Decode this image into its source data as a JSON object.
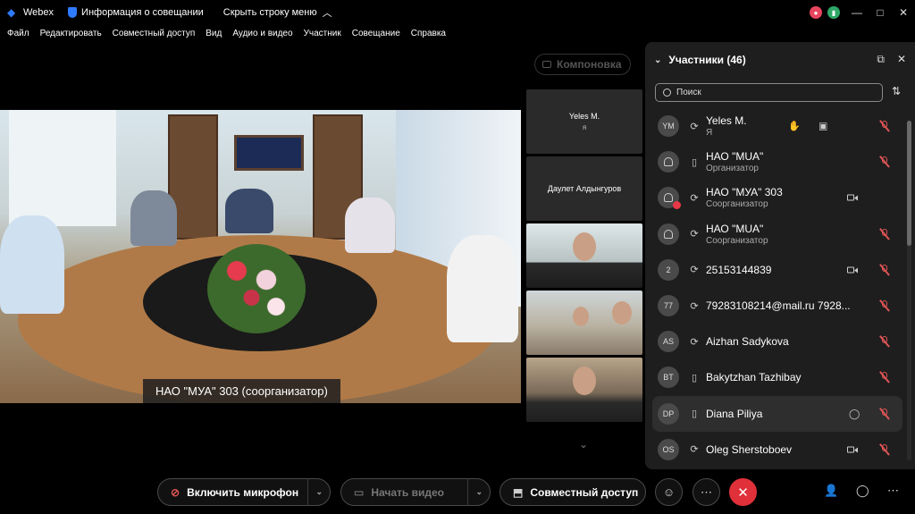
{
  "titlebar": {
    "app": "Webex",
    "meeting_info": "Информация о совещании",
    "hide_bar": "Скрыть строку меню",
    "minimize": "—",
    "maximize": "□",
    "close": "✕"
  },
  "menu": [
    "Файл",
    "Редактировать",
    "Совместный доступ",
    "Вид",
    "Аудио и видео",
    "Участник",
    "Совещание",
    "Справка"
  ],
  "layout_button": "Компоновка",
  "main_video": {
    "caption": "НАО \"МУА\" 303 (соорганизатор)"
  },
  "tiles": [
    {
      "name": "Yeles M.",
      "sub": "я"
    },
    {
      "name": "Даулет Алдынгуров",
      "sub": ""
    }
  ],
  "panel": {
    "title": "Участники (46)",
    "search_placeholder": "Поиск",
    "participants": [
      {
        "initials": "YM",
        "name": "Yeles M.",
        "role": "Я",
        "device": "sync",
        "hand": true,
        "cc": true,
        "video": false,
        "muted": true
      },
      {
        "initials": "",
        "name": "НАО \"МUA\"",
        "role": "Организатор",
        "device": "phone",
        "video": false,
        "muted": true
      },
      {
        "initials": "",
        "name": "НАО \"МУА\" 303",
        "role": "Соорганизатор",
        "device": "sync",
        "video": true,
        "muted": false
      },
      {
        "initials": "",
        "name": "НАО \"МUA\"",
        "role": "Соорганизатор",
        "device": "sync",
        "video": false,
        "muted": true
      },
      {
        "initials": "2",
        "name": "25153144839",
        "role": "",
        "device": "sync",
        "video": true,
        "muted": true
      },
      {
        "initials": "77",
        "name": "79283108214@mail.ru 7928...",
        "role": "",
        "device": "sync",
        "video": false,
        "muted": true
      },
      {
        "initials": "AS",
        "name": "Aizhan Sadykova",
        "role": "",
        "device": "sync",
        "video": false,
        "muted": true
      },
      {
        "initials": "BT",
        "name": "Bakytzhan Tazhibay",
        "role": "",
        "device": "phone",
        "video": false,
        "muted": true
      },
      {
        "initials": "DP",
        "name": "Diana Piliya",
        "role": "",
        "device": "phone",
        "chat": true,
        "video": false,
        "muted": true
      },
      {
        "initials": "OS",
        "name": "Oleg Sherstoboev",
        "role": "",
        "device": "sync",
        "video": true,
        "muted": true
      }
    ]
  },
  "toolbar": {
    "unmute": "Включить микрофон",
    "start_video": "Начать видео",
    "share": "Совместный доступ"
  },
  "colors": {
    "accent": "#2f7bff",
    "end_call": "#e0303a",
    "muted": "#e05555"
  }
}
